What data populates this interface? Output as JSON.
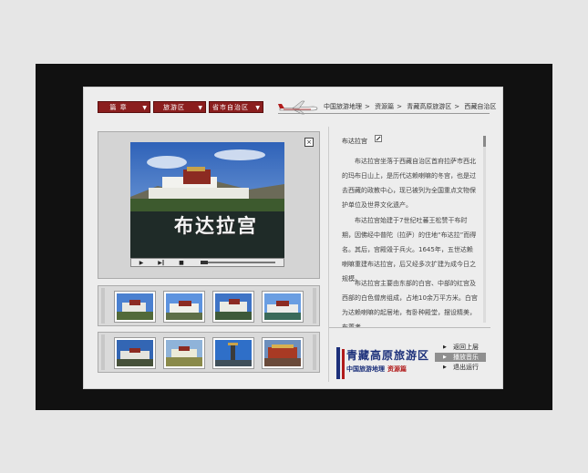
{
  "nav": {
    "dropdowns": [
      {
        "label": "篇 章"
      },
      {
        "label": "旅游区"
      },
      {
        "label": "省市自治区"
      }
    ],
    "breadcrumb": [
      "中国旅游地理",
      "资源篇",
      "青藏高原旅游区",
      "西藏自治区"
    ],
    "separator": ">"
  },
  "player": {
    "caption": "布达拉宫",
    "controls": [
      "▶",
      "▶‖",
      "■"
    ],
    "close": "×"
  },
  "article": {
    "title": "布达拉宫",
    "paragraphs": [
      "布达拉宫坐落于西藏自治区首府拉萨市西北的玛布日山上，是历代达赖喇嘛的冬宫，也是过去西藏的政教中心，现已被列为全国重点文物保护单位及世界文化遗产。",
      "布达拉宫始建于7世纪吐蕃王松赞干布时期，因佛经中普陀（拉萨）的住地“布达拉”而得名。其后，宫殿毁于兵火。1645年，五世达赖喇嘛重建布达拉宫，后又经多次扩建为成今日之规模。",
      "布达拉宫主要由东部的白宫、中部的红宫及西部的白色僧房组成，占地10余万平方米。白宫为达赖喇嘛的起居地，有卧种殿堂，摆设精美，布置考"
    ]
  },
  "logo": {
    "title": "青藏高原旅游区",
    "sub": "中国旅游地理",
    "sub_highlight": "资源篇"
  },
  "menu": [
    {
      "label": "返回上层",
      "active": false
    },
    {
      "label": "播放音乐",
      "active": true
    },
    {
      "label": "退出运行",
      "active": false
    }
  ],
  "colors": {
    "accent_red": "#8b1e1e",
    "brand_blue": "#1b2f7a",
    "panel_bg": "#ededed"
  }
}
